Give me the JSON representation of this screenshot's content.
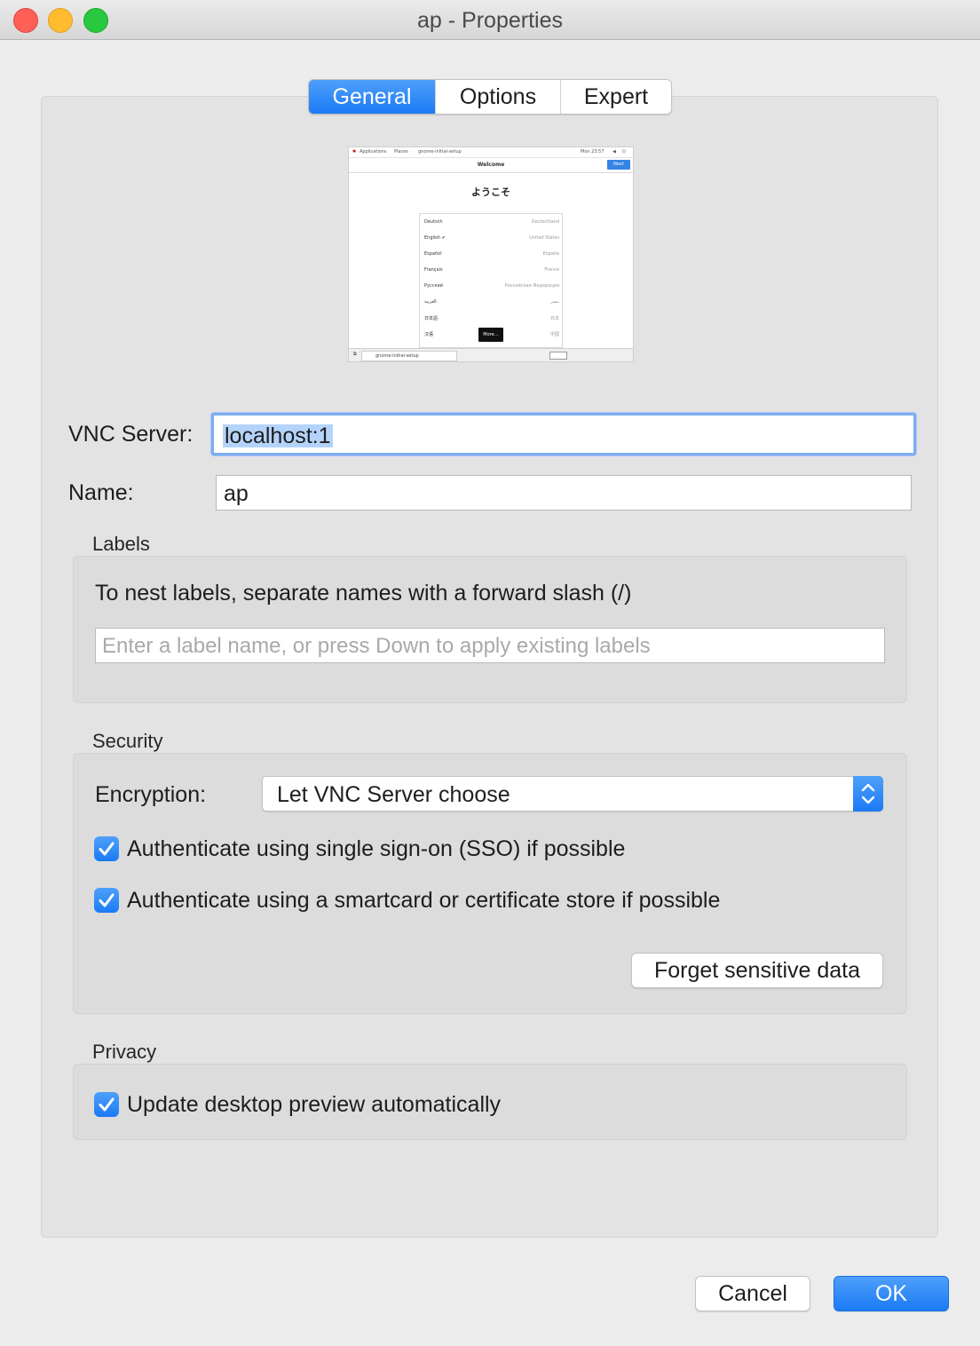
{
  "window": {
    "title": "ap - Properties"
  },
  "tabs": [
    {
      "label": "General",
      "selected": true
    },
    {
      "label": "Options",
      "selected": false
    },
    {
      "label": "Expert",
      "selected": false
    }
  ],
  "preview": {
    "topbar": {
      "apps": "Applications",
      "places": "Places",
      "app": "gnome-initial-setup",
      "clock": "Mon 23:57"
    },
    "header_title": "Welcome",
    "next_button": "Next",
    "greeting": "ようこそ",
    "languages": [
      {
        "name": "Deutsch",
        "region": "Deutschland"
      },
      {
        "name": "English ✔",
        "region": "United States"
      },
      {
        "name": "Español",
        "region": "España"
      },
      {
        "name": "Français",
        "region": "France"
      },
      {
        "name": "Русский",
        "region": "Российская Федерация"
      },
      {
        "name": "العربية",
        "region": "مصر"
      },
      {
        "name": "日本語",
        "region": "日本"
      },
      {
        "name": "汉语",
        "region": "中国"
      }
    ],
    "more_button": "More…",
    "taskbar_item": "gnome-initial-setup"
  },
  "vnc_server": {
    "label": "VNC Server:",
    "value": "localhost:1"
  },
  "name": {
    "label": "Name:",
    "value": "ap"
  },
  "labels": {
    "section_title": "Labels",
    "hint": "To nest labels, separate names with a forward slash (/)",
    "placeholder": "Enter a label name, or press Down to apply existing labels"
  },
  "security": {
    "section_title": "Security",
    "encryption_label": "Encryption:",
    "encryption_value": "Let VNC Server choose",
    "sso_label": "Authenticate using single sign-on (SSO) if possible",
    "sso_checked": true,
    "smartcard_label": "Authenticate using a smartcard or certificate store if possible",
    "smartcard_checked": true,
    "forget_button": "Forget sensitive data"
  },
  "privacy": {
    "section_title": "Privacy",
    "update_preview_label": "Update desktop preview automatically",
    "update_preview_checked": true
  },
  "buttons": {
    "cancel": "Cancel",
    "ok": "OK"
  },
  "colors": {
    "accent": "#1a7af5",
    "focus_ring": "#7eadf0",
    "selection": "#b4d3fb",
    "window_bg": "#ececec"
  }
}
